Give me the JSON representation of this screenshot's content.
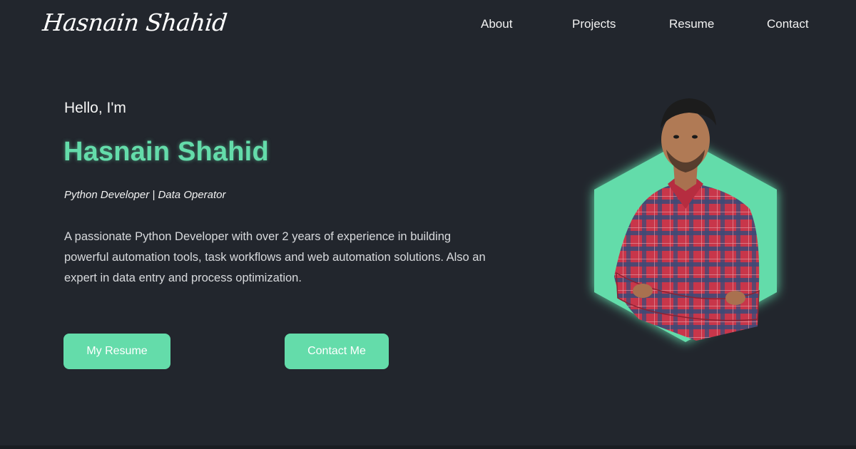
{
  "header": {
    "logo_text": "Hasnain Shahid",
    "nav": {
      "about": "About",
      "projects": "Projects",
      "resume": "Resume",
      "contact": "Contact"
    }
  },
  "hero": {
    "greeting": "Hello, I'm",
    "name": "Hasnain Shahid",
    "role": "Python Developer | Data Operator",
    "bio": "A passionate Python Developer with over 2 years of experience in building powerful automation tools, task workflows and web automation solutions. Also an expert in data entry and process optimization.",
    "buttons": {
      "resume": "My Resume",
      "contact": "Contact Me"
    }
  },
  "colors": {
    "background": "#22262d",
    "accent": "#64dcaa",
    "text": "#f0f0f0",
    "shirt_red": "#c8364a",
    "shirt_blue": "#3b4a78"
  },
  "icons": {
    "portrait": "person-portrait-icon"
  }
}
